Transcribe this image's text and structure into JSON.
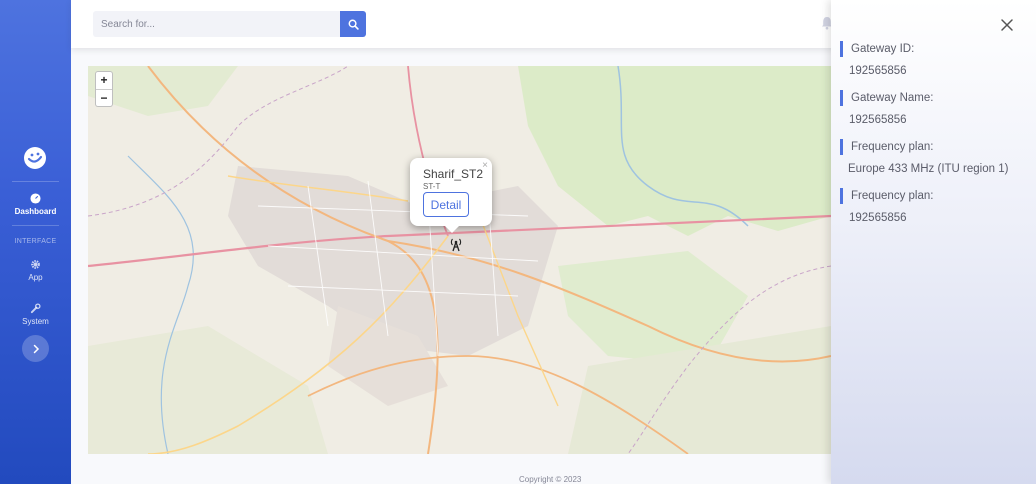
{
  "search": {
    "placeholder": "Search for..."
  },
  "sidebar": {
    "items": [
      {
        "label": "Dashboard",
        "icon": "gauge-icon"
      },
      {
        "label": "App",
        "icon": "gear-icon"
      },
      {
        "label": "System",
        "icon": "wrench-icon"
      }
    ],
    "heading": "INTERFACE"
  },
  "map": {
    "popup": {
      "title": "Sharif_ST2",
      "subtitle": "ST-T",
      "button_label": "Detail"
    },
    "zoom_in": "+",
    "zoom_out": "−",
    "popup_close": "×"
  },
  "footer": {
    "copyright": "Copyright © 2023"
  },
  "panel": {
    "fields": [
      {
        "label": "Gateway ID:",
        "value": "192565856"
      },
      {
        "label": "Gateway Name:",
        "value": "192565856"
      },
      {
        "label": "Frequency plan:",
        "value": "Europe 433 MHz (ITU region 1)"
      },
      {
        "label": "Frequency plan:",
        "value": "192565856"
      }
    ]
  },
  "colors": {
    "accent": "#4e73df",
    "sidebar_dark": "#224abe"
  }
}
